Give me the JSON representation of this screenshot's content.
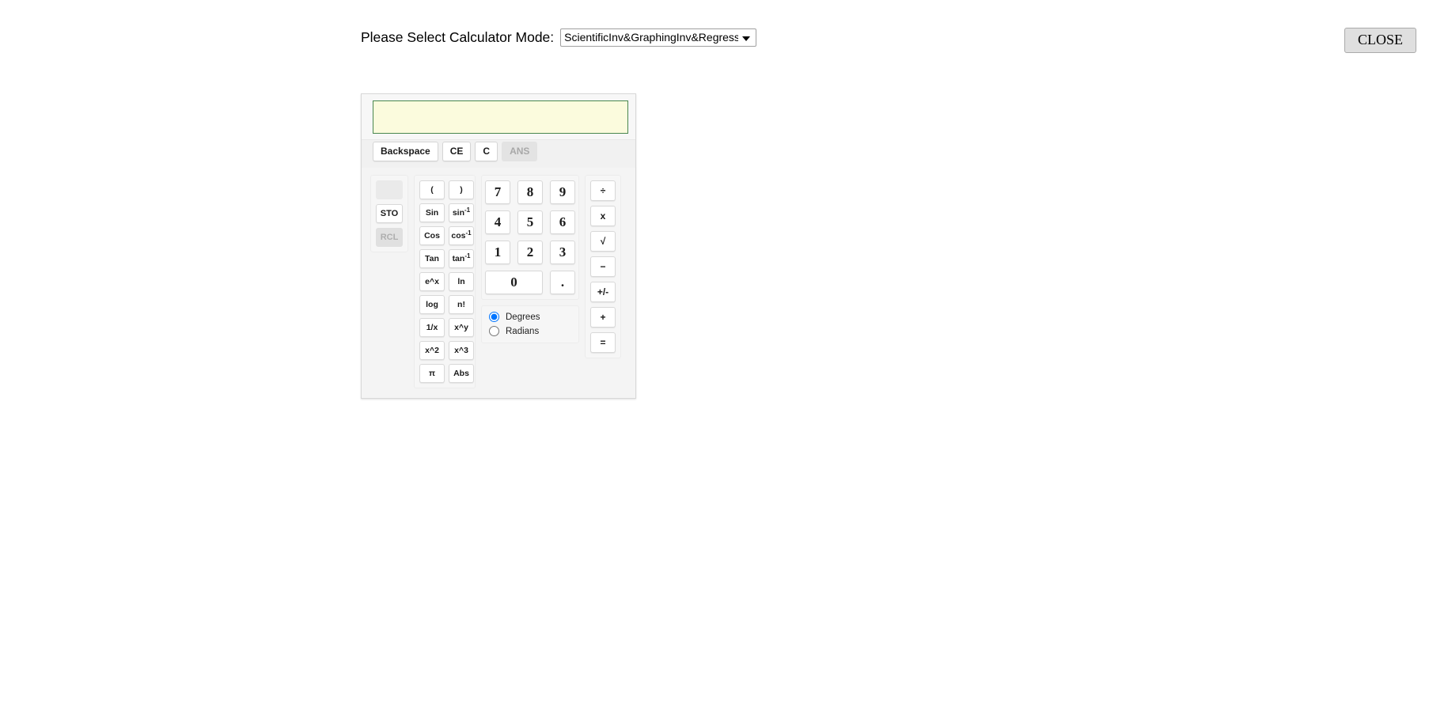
{
  "header": {
    "mode_label": "Please Select Calculator Mode:",
    "mode_selected": "ScientificInv&GraphingInv&Regression",
    "mode_options": [
      "ScientificInv&GraphingInv&Regression"
    ],
    "dropdown_icon": "chevron-down-icon",
    "close_label": "CLOSE"
  },
  "calculator": {
    "display_value": "",
    "display_placeholder": "",
    "edit_buttons": [
      {
        "label": "Backspace",
        "name": "backspace-button",
        "disabled": false
      },
      {
        "label": "CE",
        "name": "clear-entry-button",
        "disabled": false
      },
      {
        "label": "C",
        "name": "clear-button",
        "disabled": false
      },
      {
        "label": "ANS",
        "name": "answer-button",
        "disabled": true
      }
    ],
    "memory_buttons": [
      {
        "label": "",
        "name": "memory-blank-button",
        "disabled": true
      },
      {
        "label": "STO",
        "name": "store-button",
        "disabled": false
      },
      {
        "label": "RCL",
        "name": "recall-button",
        "disabled": true
      }
    ],
    "function_buttons": [
      {
        "label": "(",
        "sup": "",
        "name": "open-paren-button"
      },
      {
        "label": ")",
        "sup": "",
        "name": "close-paren-button"
      },
      {
        "label": "Sin",
        "sup": "",
        "name": "sin-button"
      },
      {
        "label": "sin",
        "sup": "-1",
        "name": "arcsin-button"
      },
      {
        "label": "Cos",
        "sup": "",
        "name": "cos-button"
      },
      {
        "label": "cos",
        "sup": "-1",
        "name": "arccos-button"
      },
      {
        "label": "Tan",
        "sup": "",
        "name": "tan-button"
      },
      {
        "label": "tan",
        "sup": "-1",
        "name": "arctan-button"
      },
      {
        "label": "e^x",
        "sup": "",
        "name": "exp-button"
      },
      {
        "label": "ln",
        "sup": "",
        "name": "ln-button"
      },
      {
        "label": "log",
        "sup": "",
        "name": "log-button"
      },
      {
        "label": "n!",
        "sup": "",
        "name": "factorial-button"
      },
      {
        "label": "1/x",
        "sup": "",
        "name": "reciprocal-button"
      },
      {
        "label": "x^y",
        "sup": "",
        "name": "power-button"
      },
      {
        "label": "x^2",
        "sup": "",
        "name": "square-button"
      },
      {
        "label": "x^3",
        "sup": "",
        "name": "cube-button"
      },
      {
        "label": "π",
        "sup": "",
        "name": "pi-button"
      },
      {
        "label": "Abs",
        "sup": "",
        "name": "abs-button"
      }
    ],
    "number_buttons": [
      {
        "label": "7",
        "name": "digit-7-button",
        "wide": false
      },
      {
        "label": "8",
        "name": "digit-8-button",
        "wide": false
      },
      {
        "label": "9",
        "name": "digit-9-button",
        "wide": false
      },
      {
        "label": "4",
        "name": "digit-4-button",
        "wide": false
      },
      {
        "label": "5",
        "name": "digit-5-button",
        "wide": false
      },
      {
        "label": "6",
        "name": "digit-6-button",
        "wide": false
      },
      {
        "label": "1",
        "name": "digit-1-button",
        "wide": false
      },
      {
        "label": "2",
        "name": "digit-2-button",
        "wide": false
      },
      {
        "label": "3",
        "name": "digit-3-button",
        "wide": false
      },
      {
        "label": "0",
        "name": "digit-0-button",
        "wide": true
      },
      {
        "label": ".",
        "name": "decimal-point-button",
        "wide": false
      }
    ],
    "angle_modes": [
      {
        "label": "Degrees",
        "name": "degrees-radio",
        "selected": true
      },
      {
        "label": "Radians",
        "name": "radians-radio",
        "selected": false
      }
    ],
    "operator_buttons": [
      {
        "label": "÷",
        "name": "divide-button"
      },
      {
        "label": "x",
        "name": "multiply-button"
      },
      {
        "label": "√",
        "name": "sqrt-button"
      },
      {
        "label": "−",
        "name": "subtract-button"
      },
      {
        "label": "+/-",
        "name": "sign-toggle-button"
      },
      {
        "label": "+",
        "name": "add-button"
      },
      {
        "label": "=",
        "name": "equals-button"
      }
    ]
  },
  "colors": {
    "page_background": "#ffffff",
    "display_background": "#fbfbdd",
    "display_border": "#49874f",
    "panel_background": "#f4f4f4",
    "button_background": "#ffffff",
    "disabled_background": "#e0e0e0",
    "disabled_text": "#aeaeae",
    "close_background": "#dfdfdf",
    "radio_accent": "#1a6fb5"
  }
}
